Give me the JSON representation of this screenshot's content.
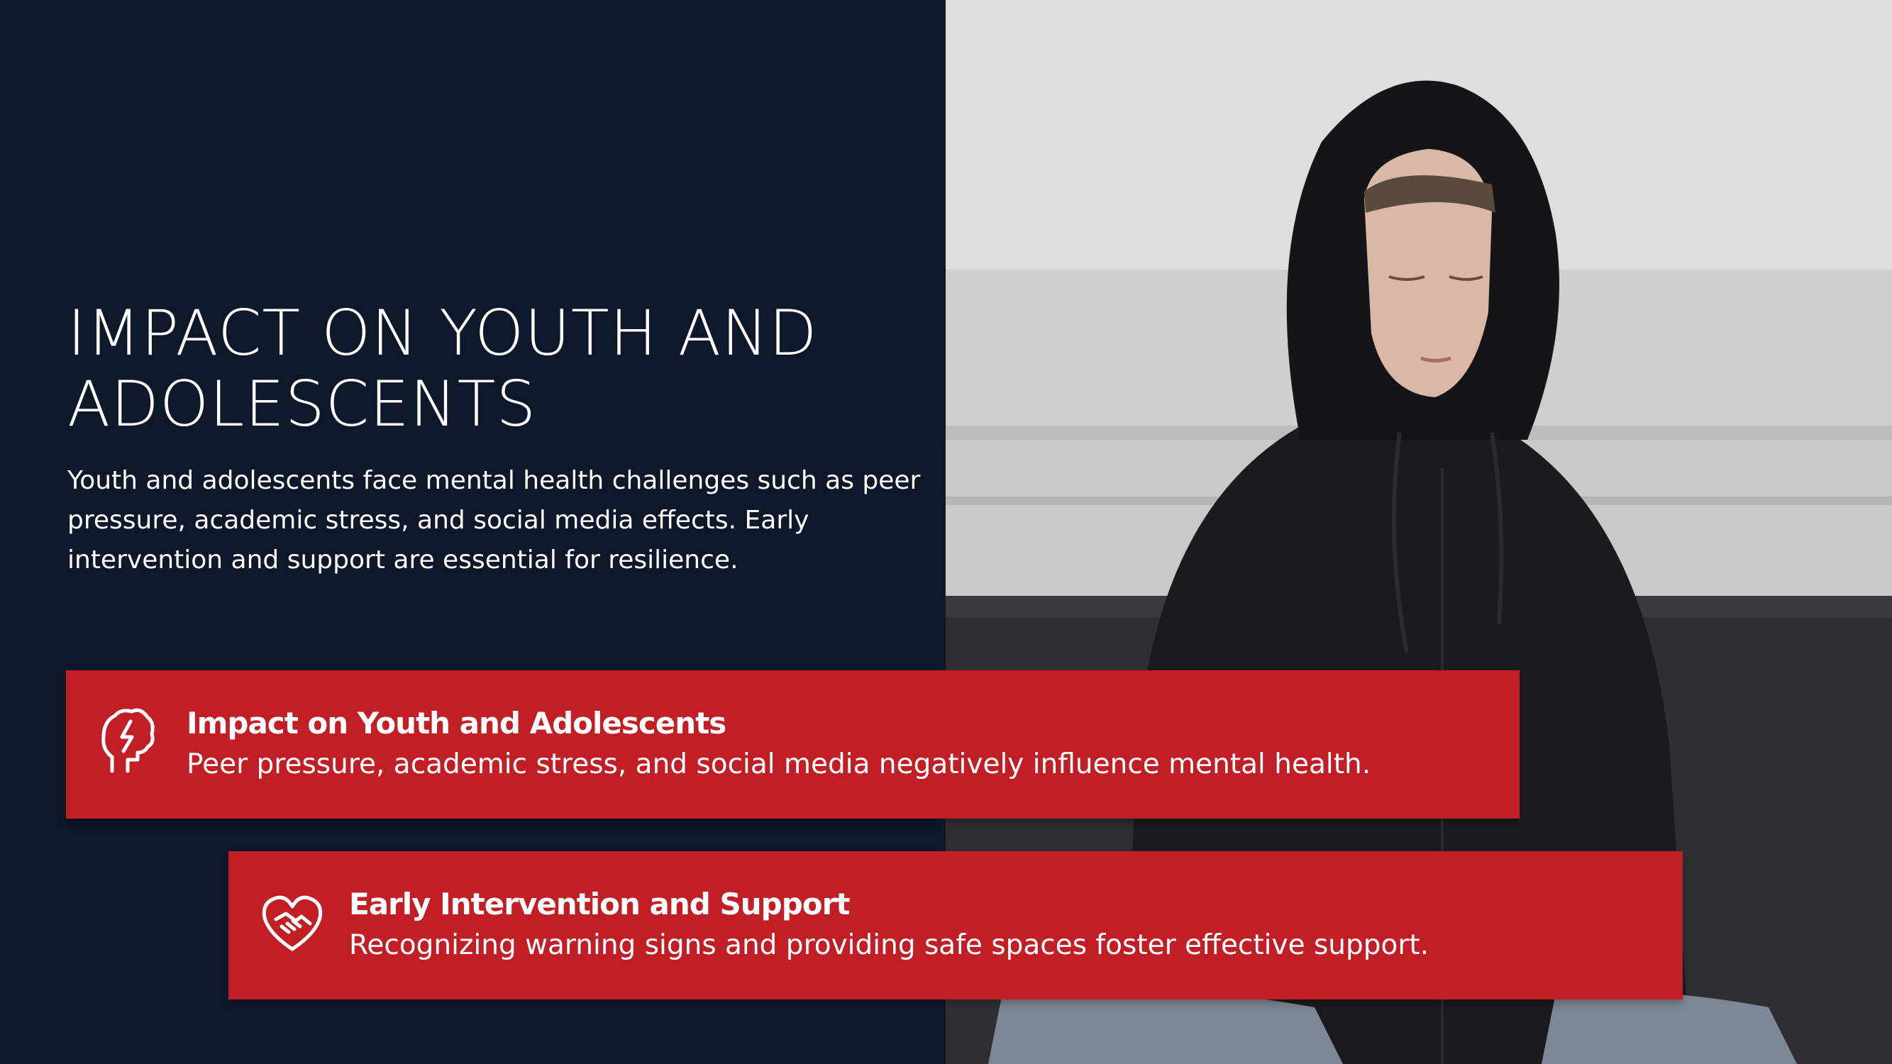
{
  "slide": {
    "title": "IMPACT ON YOUTH AND ADOLESCENTS",
    "subtitle": "Youth and adolescents face mental health challenges such as peer pressure, academic stress, and social media effects. Early intervention and support are essential for resilience."
  },
  "cards": [
    {
      "icon": "brain-lightning-icon",
      "title": "Impact on Youth and Adolescents",
      "text": "Peer pressure, academic stress, and social media negatively influence mental health."
    },
    {
      "icon": "heart-handshake-icon",
      "title": "Early Intervention and Support",
      "text": "Recognizing warning signs and providing safe spaces foster effective support."
    }
  ],
  "colors": {
    "background": "#0e1829",
    "accent": "#c21e26",
    "text": "#ffffff"
  },
  "photo": {
    "subject": "teenager in black hoodie seated with eyes closed"
  }
}
